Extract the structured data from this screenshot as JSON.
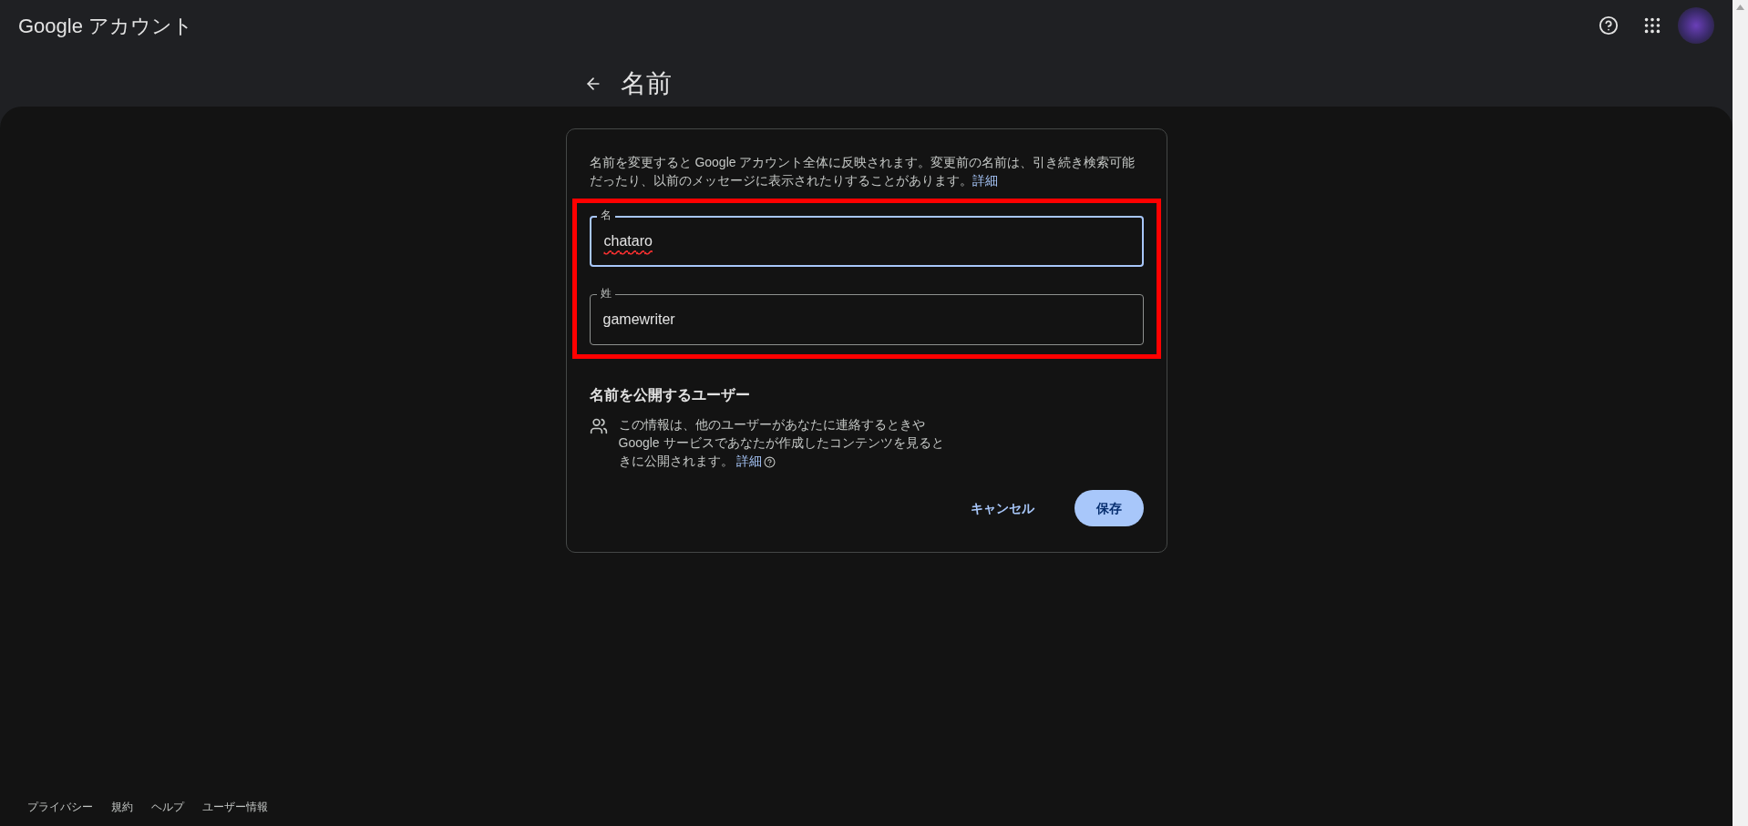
{
  "header": {
    "logo": "Google",
    "product": "アカウント"
  },
  "page": {
    "title": "名前"
  },
  "card": {
    "intro": "名前を変更すると Google アカウント全体に反映されます。変更前の名前は、引き続き検索可能だったり、以前のメッセージに表示されたりすることがあります。",
    "intro_link": "詳細",
    "fields": [
      {
        "label": "名",
        "value": "chataro",
        "focused": true,
        "misspelled": true
      },
      {
        "label": "姓",
        "value": "gamewriter",
        "focused": false,
        "misspelled": false
      }
    ],
    "visibility": {
      "heading": "名前を公開するユーザー",
      "text": "この情報は、他のユーザーがあなたに連絡するときや Google サービスであなたが作成したコンテンツを見るときに公開されます。",
      "link": "詳細"
    },
    "buttons": [
      {
        "label": "キャンセル",
        "kind": "text"
      },
      {
        "label": "保存",
        "kind": "filled"
      }
    ]
  },
  "footer": [
    "プライバシー",
    "規約",
    "ヘルプ",
    "ユーザー情報"
  ]
}
